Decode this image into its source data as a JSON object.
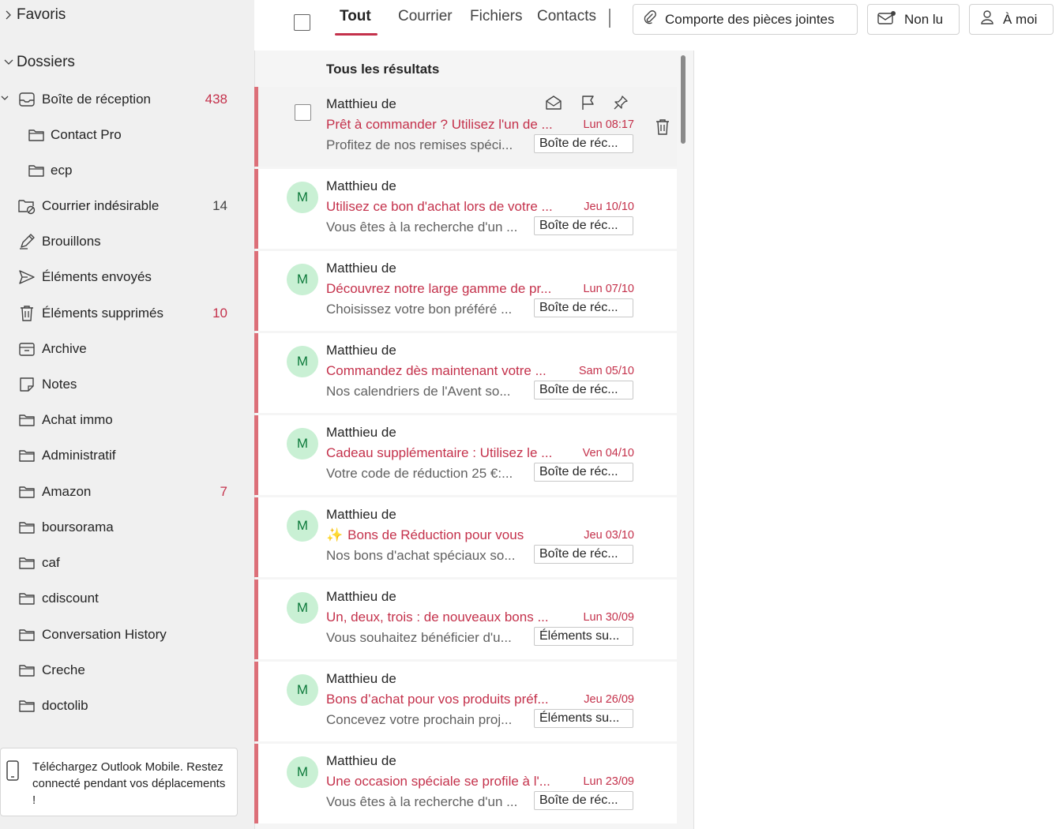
{
  "sidebar": {
    "favorites_label": "Favoris",
    "folders_label": "Dossiers",
    "folders": [
      {
        "label": "Boîte de réception",
        "count": "438",
        "icon": "inbox-icon"
      },
      {
        "label": "Contact Pro",
        "count": "",
        "icon": "folder-icon"
      },
      {
        "label": "ecp",
        "count": "",
        "icon": "folder-icon"
      },
      {
        "label": "Courrier indésirable",
        "count": "14",
        "icon": "junk-icon"
      },
      {
        "label": "Brouillons",
        "count": "",
        "icon": "drafts-icon"
      },
      {
        "label": "Éléments envoyés",
        "count": "",
        "icon": "send-icon"
      },
      {
        "label": "Éléments supprimés",
        "count": "10",
        "icon": "trash-icon"
      },
      {
        "label": "Archive",
        "count": "",
        "icon": "archive-icon"
      },
      {
        "label": "Notes",
        "count": "",
        "icon": "note-icon"
      },
      {
        "label": "Achat immo",
        "count": "",
        "icon": "folder-icon"
      },
      {
        "label": "Administratif",
        "count": "",
        "icon": "folder-icon"
      },
      {
        "label": "Amazon",
        "count": "7",
        "icon": "folder-icon"
      },
      {
        "label": "boursorama",
        "count": "",
        "icon": "folder-icon"
      },
      {
        "label": "caf",
        "count": "",
        "icon": "folder-icon"
      },
      {
        "label": "cdiscount",
        "count": "",
        "icon": "folder-icon"
      },
      {
        "label": "Conversation History",
        "count": "",
        "icon": "folder-icon"
      },
      {
        "label": "Creche",
        "count": "",
        "icon": "folder-icon"
      },
      {
        "label": "doctolib",
        "count": "",
        "icon": "folder-icon"
      }
    ],
    "promo_text": "Téléchargez Outlook Mobile. Restez connecté pendant vos déplacements !"
  },
  "toolbar": {
    "tabs": [
      "Tout",
      "Courrier",
      "Fichiers",
      "Contacts"
    ],
    "filter_attachments": "Comporte des pièces jointes",
    "filter_unread": "Non lu",
    "filter_to_me": "À moi"
  },
  "list": {
    "header": "Tous les résultats",
    "messages": [
      {
        "sender": "Matthieu de",
        "subject": "Prêt à commander ? Utilisez l'un de ...",
        "date": "Lun 08:17",
        "preview": "Profitez de nos remises spéci...",
        "folder": "Boîte de réc..."
      },
      {
        "sender": "Matthieu de",
        "subject": "Utilisez ce bon d'achat lors de votre ...",
        "date": "Jeu 10/10",
        "preview": "Vous êtes à la recherche d'un ...",
        "folder": "Boîte de réc...",
        "avatar": "M"
      },
      {
        "sender": "Matthieu de",
        "subject": "Découvrez notre large gamme de pr...",
        "date": "Lun 07/10",
        "preview": "Choisissez votre bon préféré ...",
        "folder": "Boîte de réc...",
        "avatar": "M"
      },
      {
        "sender": "Matthieu de",
        "subject": "Commandez dès maintenant votre ...",
        "date": "Sam 05/10",
        "preview": "Nos calendriers de l'Avent so...",
        "folder": "Boîte de réc...",
        "avatar": "M"
      },
      {
        "sender": "Matthieu de",
        "subject": "Cadeau supplémentaire : Utilisez le ...",
        "date": "Ven 04/10",
        "preview": "Votre code de réduction 25 €:...",
        "folder": "Boîte de réc...",
        "avatar": "M"
      },
      {
        "sender": "Matthieu de",
        "subject": "Bons de Réduction pour vous",
        "date": "Jeu 03/10",
        "preview": "Nos bons d'achat spéciaux so...",
        "folder": "Boîte de réc...",
        "avatar": "M"
      },
      {
        "sender": "Matthieu de",
        "subject": "Un, deux, trois : de nouveaux bons ...",
        "date": "Lun 30/09",
        "preview": "Vous souhaitez bénéficier d'u...",
        "folder": "Éléments su...",
        "avatar": "M"
      },
      {
        "sender": "Matthieu de",
        "subject": "Bons d’achat pour vos produits préf...",
        "date": "Jeu 26/09",
        "preview": "Concevez votre prochain proj...",
        "folder": "Éléments su...",
        "avatar": "M"
      },
      {
        "sender": "Matthieu de",
        "subject": "Une occasion spéciale se profile à l'...",
        "date": "Lun 23/09",
        "preview": "Vous êtes à la recherche d'un ...",
        "folder": "Boîte de réc...",
        "avatar": "M"
      }
    ]
  },
  "colors": {
    "accent": "#c4314b",
    "unread_bar": "#dc6f78",
    "avatar_bg": "#c9f0d4",
    "sidebar_bg": "#f0f0f0"
  }
}
